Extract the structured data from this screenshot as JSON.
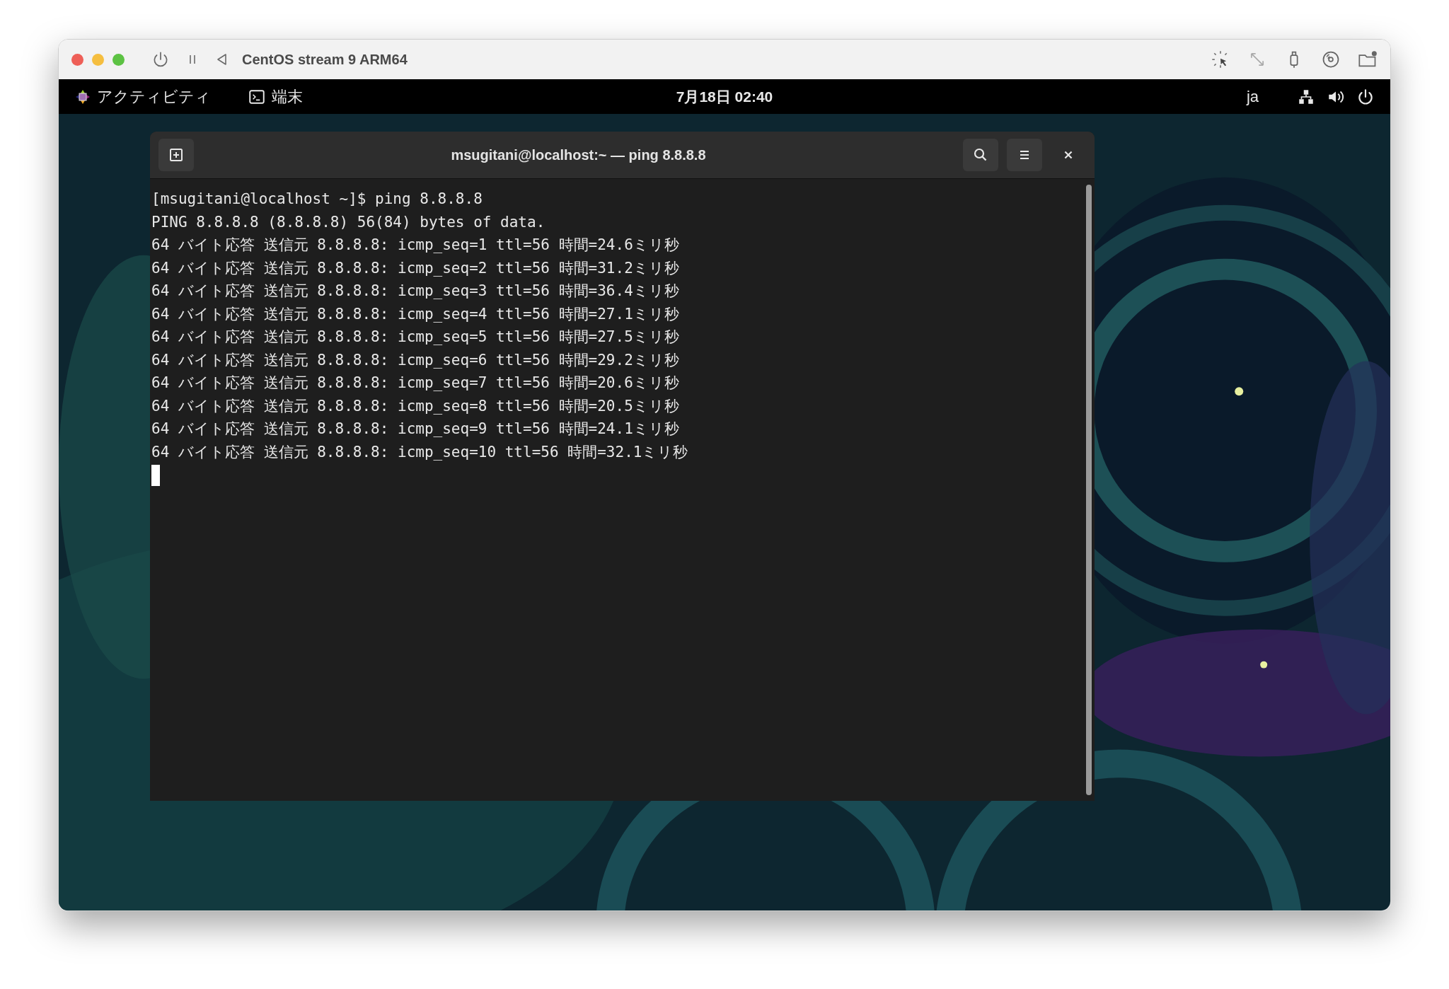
{
  "vm_window": {
    "title": "CentOS stream 9 ARM64"
  },
  "top_bar": {
    "activities": "アクティビティ",
    "app": "端末",
    "clock": "7月18日 02:40",
    "input_method": "ja"
  },
  "terminal": {
    "title": "msugitani@localhost:~ — ping 8.8.8.8",
    "lines": [
      "[msugitani@localhost ~]$ ping 8.8.8.8",
      "PING 8.8.8.8 (8.8.8.8) 56(84) bytes of data.",
      "64 バイト応答 送信元 8.8.8.8: icmp_seq=1 ttl=56 時間=24.6ミリ秒",
      "64 バイト応答 送信元 8.8.8.8: icmp_seq=2 ttl=56 時間=31.2ミリ秒",
      "64 バイト応答 送信元 8.8.8.8: icmp_seq=3 ttl=56 時間=36.4ミリ秒",
      "64 バイト応答 送信元 8.8.8.8: icmp_seq=4 ttl=56 時間=27.1ミリ秒",
      "64 バイト応答 送信元 8.8.8.8: icmp_seq=5 ttl=56 時間=27.5ミリ秒",
      "64 バイト応答 送信元 8.8.8.8: icmp_seq=6 ttl=56 時間=29.2ミリ秒",
      "64 バイト応答 送信元 8.8.8.8: icmp_seq=7 ttl=56 時間=20.6ミリ秒",
      "64 バイト応答 送信元 8.8.8.8: icmp_seq=8 ttl=56 時間=20.5ミリ秒",
      "64 バイト応答 送信元 8.8.8.8: icmp_seq=9 ttl=56 時間=24.1ミリ秒",
      "64 バイト応答 送信元 8.8.8.8: icmp_seq=10 ttl=56 時間=32.1ミリ秒"
    ]
  }
}
